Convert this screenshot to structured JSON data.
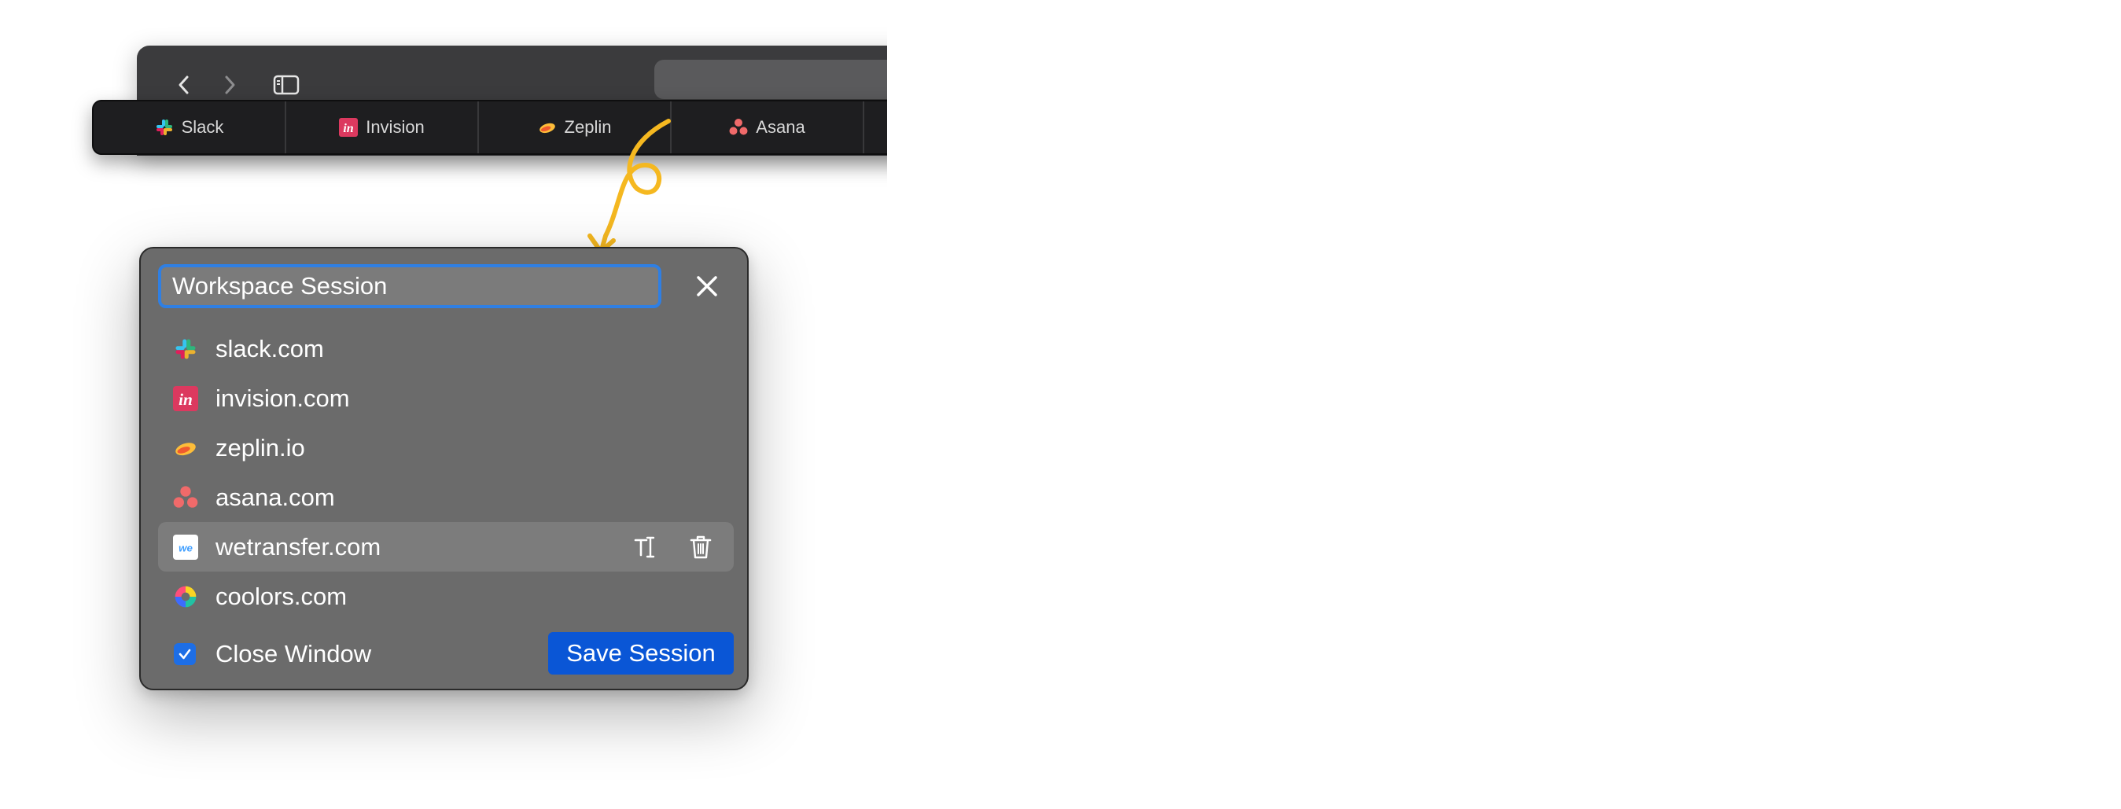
{
  "browser": {
    "tabs": [
      {
        "label": "Slack",
        "icon": "slack-icon"
      },
      {
        "label": "Invision",
        "icon": "invision-icon"
      },
      {
        "label": "Zeplin",
        "icon": "zeplin-icon"
      },
      {
        "label": "Asana",
        "icon": "asana-icon"
      }
    ],
    "nav": {
      "back_icon": "chevron-left-icon",
      "forward_icon": "chevron-right-icon",
      "sidebar_icon": "sidebar-icon"
    }
  },
  "session": {
    "name_value": "Workspace Session",
    "close_icon": "close-icon",
    "sites": [
      {
        "label": "slack.com",
        "icon": "slack-icon"
      },
      {
        "label": "invision.com",
        "icon": "invision-icon"
      },
      {
        "label": "zeplin.io",
        "icon": "zeplin-icon"
      },
      {
        "label": "asana.com",
        "icon": "asana-icon"
      },
      {
        "label": "wetransfer.com",
        "icon": "wetransfer-icon",
        "hovered": true,
        "actions": [
          "rename-icon",
          "trash-icon"
        ]
      },
      {
        "label": "coolors.com",
        "icon": "coolors-icon"
      }
    ],
    "close_window_label": "Close Window",
    "close_window_checked": true,
    "save_label": "Save Session"
  },
  "colors": {
    "accent": "#2f7fe3",
    "save_button": "#0a56d6",
    "panel": "#6b6b6b",
    "tabbar": "#1e1e20",
    "arrow": "#f5b820"
  }
}
